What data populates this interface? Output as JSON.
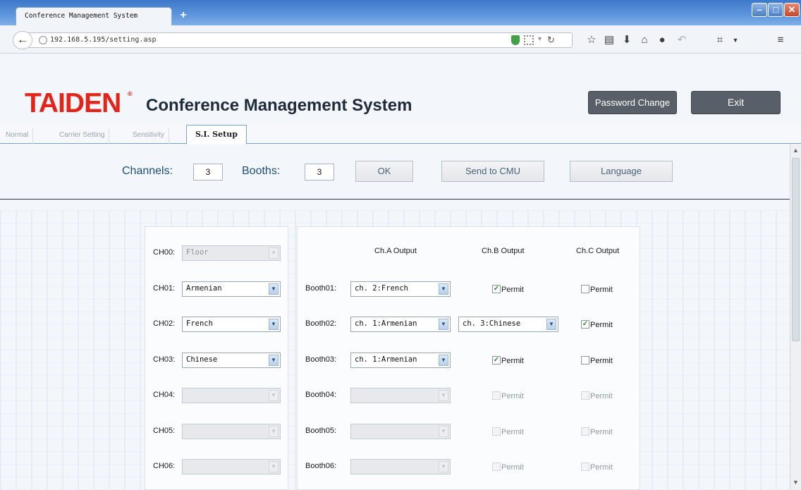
{
  "browser": {
    "tab_title": "Conference Management System",
    "tab_close": "×",
    "new_tab": "+",
    "url": "192.168.5.195/setting.asp",
    "win_min": "–",
    "win_max": "□",
    "win_close": "✕"
  },
  "header": {
    "logo": "TAIDEN",
    "logo_mark": "®",
    "title": "Conference Management System",
    "password_button": "Password Change",
    "exit_button": "Exit"
  },
  "tabs": [
    {
      "label": "Normal",
      "active": false
    },
    {
      "label": "Carrier Setting",
      "active": false
    },
    {
      "label": "Sensitivity",
      "active": false
    },
    {
      "label": "S.I. Setup",
      "active": true
    }
  ],
  "setup": {
    "channels_label": "Channels:",
    "channels_value": "3",
    "booths_label": "Booths:",
    "booths_value": "3",
    "ok_button": "OK",
    "send_button": "Send to CMU",
    "language_button": "Language"
  },
  "channels": [
    {
      "label": "CH00:",
      "value": "Floor",
      "enabled": false
    },
    {
      "label": "CH01:",
      "value": "Armenian",
      "enabled": true
    },
    {
      "label": "CH02:",
      "value": "French",
      "enabled": true
    },
    {
      "label": "CH03:",
      "value": "Chinese",
      "enabled": true
    },
    {
      "label": "CH04:",
      "value": "",
      "enabled": false
    },
    {
      "label": "CH05:",
      "value": "",
      "enabled": false
    },
    {
      "label": "CH06:",
      "value": "",
      "enabled": false
    }
  ],
  "booth_headers": {
    "a": "Ch.A Output",
    "b": "Ch.B Output",
    "c": "Ch.C Output"
  },
  "booths": [
    {
      "label": "Booth01:",
      "a": "ch. 2:French",
      "a_enabled": true,
      "b_type": "permit",
      "b_checked": true,
      "b_enabled": true,
      "b_label": "Permit",
      "c_checked": false,
      "c_enabled": true,
      "c_label": "Permit"
    },
    {
      "label": "Booth02:",
      "a": "ch. 1:Armenian",
      "a_enabled": true,
      "b_type": "select",
      "b_value": "ch. 3:Chinese",
      "b_enabled": true,
      "c_checked": true,
      "c_enabled": true,
      "c_label": "Permit"
    },
    {
      "label": "Booth03:",
      "a": "ch. 1:Armenian",
      "a_enabled": true,
      "b_type": "permit",
      "b_checked": true,
      "b_enabled": true,
      "b_label": "Permit",
      "c_checked": false,
      "c_enabled": true,
      "c_label": "Permit"
    },
    {
      "label": "Booth04:",
      "a": "",
      "a_enabled": false,
      "b_type": "permit",
      "b_checked": false,
      "b_enabled": false,
      "b_label": "Permit",
      "c_checked": false,
      "c_enabled": false,
      "c_label": "Permit"
    },
    {
      "label": "Booth05:",
      "a": "",
      "a_enabled": false,
      "b_type": "permit",
      "b_checked": false,
      "b_enabled": false,
      "b_label": "Permit",
      "c_checked": false,
      "c_enabled": false,
      "c_label": "Permit"
    },
    {
      "label": "Booth06:",
      "a": "",
      "a_enabled": false,
      "b_type": "permit",
      "b_checked": false,
      "b_enabled": false,
      "b_label": "Permit",
      "c_checked": false,
      "c_enabled": false,
      "c_label": "Permit"
    }
  ],
  "colors": {
    "logo_red": "#e1251b",
    "title_bar_blue": "#3d78c9",
    "dark_button": "#595f68"
  }
}
